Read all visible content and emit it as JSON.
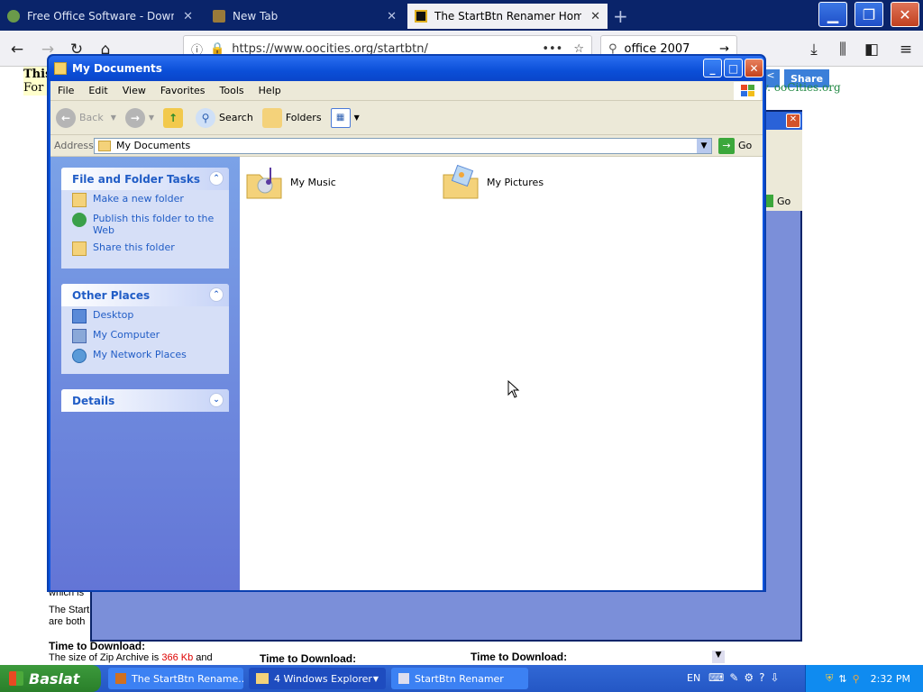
{
  "browser": {
    "tabs": [
      {
        "title": "Free Office Software - Download"
      },
      {
        "title": "New Tab"
      },
      {
        "title": "The StartBtn Renamer Home Page"
      }
    ],
    "url": "https://www.oocities.org/startbtn/",
    "search_text": "office 2007"
  },
  "page": {
    "top_left_1": "This",
    "top_left_2": "For",
    "share_label": "Share",
    "site_credit": "y. ooCities.org",
    "bottom_col1_title": "Time to Download:",
    "bottom_col1_text": "The size of Zip Archive is",
    "bottom_col1_size": "366 Kb",
    "bottom_col1_and": "and",
    "bottom_col2_title": "Time to Download:",
    "bottom_col3_title": "Time to Download:",
    "side_text_1": "which is",
    "side_text_2": "The Start",
    "side_text_3": "are both"
  },
  "explorer": {
    "title": "My Documents",
    "menu": [
      "File",
      "Edit",
      "View",
      "Favorites",
      "Tools",
      "Help"
    ],
    "toolbar": {
      "back": "Back",
      "search": "Search",
      "folders": "Folders"
    },
    "address_label": "Address",
    "address_value": "My Documents",
    "go_label": "Go",
    "tasks": {
      "file_folder": {
        "title": "File and Folder Tasks",
        "items": [
          "Make a new folder",
          "Publish this folder to the Web",
          "Share this folder"
        ]
      },
      "other_places": {
        "title": "Other Places",
        "items": [
          "Desktop",
          "My Computer",
          "My Network Places"
        ]
      },
      "details": {
        "title": "Details"
      }
    },
    "folders": [
      {
        "name": "My Music"
      },
      {
        "name": "My Pictures"
      }
    ]
  },
  "bg_window": {
    "go_label": "Go"
  },
  "taskbar": {
    "start_label": "Baslat",
    "items": [
      "The StartBtn Rename...",
      "4 Windows Explorer",
      "StartBtn Renamer"
    ],
    "language": "EN",
    "clock": "2:32 PM"
  }
}
